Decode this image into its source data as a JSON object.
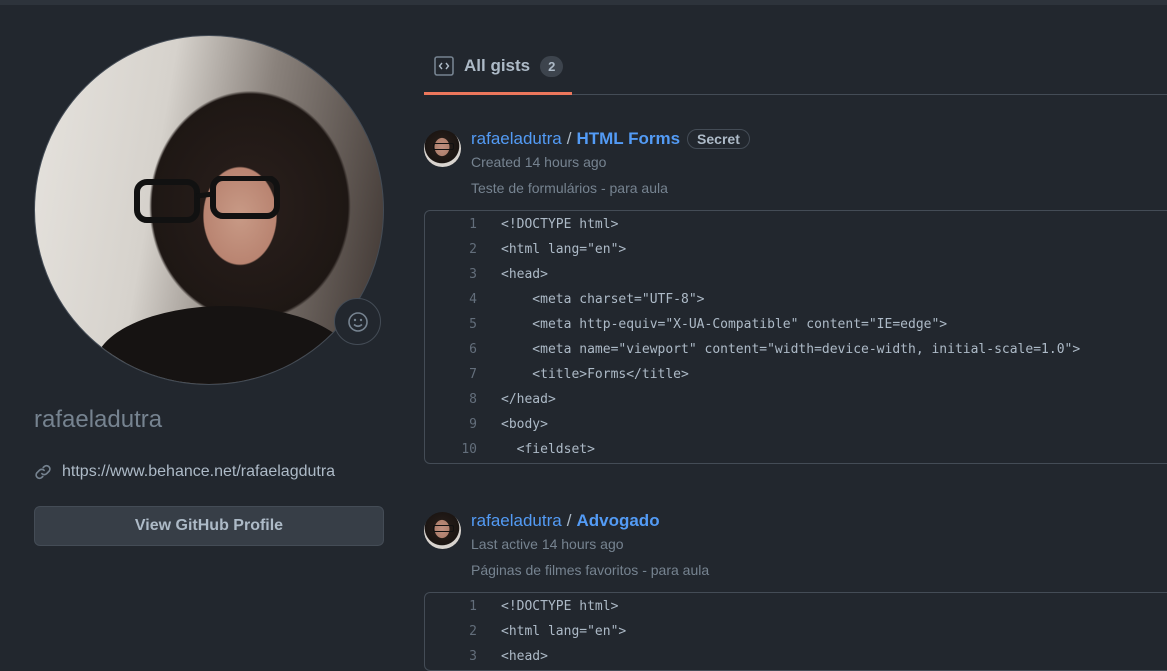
{
  "profile": {
    "username": "rafaeladutra",
    "website": "https://www.behance.net/rafaelagdutra",
    "view_profile_label": "View GitHub Profile"
  },
  "tabs": [
    {
      "label": "All gists",
      "count": "2"
    }
  ],
  "gists": [
    {
      "owner": "rafaeladutra",
      "separator": "/",
      "name": "HTML Forms",
      "badge": "Secret",
      "meta": "Created 14 hours ago",
      "description": "Teste de formulários - para aula",
      "lines": [
        "<!DOCTYPE html>",
        "<html lang=\"en\">",
        "<head>",
        "    <meta charset=\"UTF-8\">",
        "    <meta http-equiv=\"X-UA-Compatible\" content=\"IE=edge\">",
        "    <meta name=\"viewport\" content=\"width=device-width, initial-scale=1.0\">",
        "    <title>Forms</title>",
        "</head>",
        "<body>",
        "  <fieldset>"
      ]
    },
    {
      "owner": "rafaeladutra",
      "separator": "/",
      "name": "Advogado",
      "meta": "Last active 14 hours ago",
      "description": "Páginas de filmes favoritos - para aula",
      "lines": [
        "<!DOCTYPE html>",
        "<html lang=\"en\">",
        "<head>"
      ]
    }
  ],
  "colors": {
    "background": "#22272e",
    "accent": "#ec775c",
    "link": "#539bf5"
  }
}
